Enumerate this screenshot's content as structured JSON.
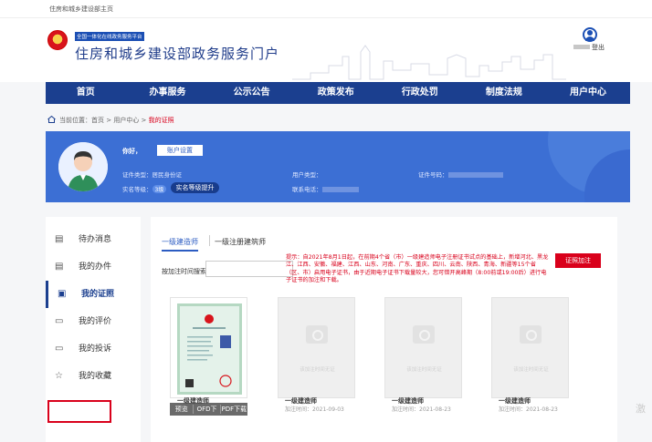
{
  "topbar": {
    "text": "住房和城乡建设部主页"
  },
  "header": {
    "badge_small": "全国一体化在线政务服务平台",
    "title": "住房和城乡建设部政务服务门户",
    "logout": "登出",
    "emblem_icon": "national-emblem-icon",
    "user_icon": "user-icon"
  },
  "nav": [
    "首页",
    "办事服务",
    "公示公告",
    "政策发布",
    "行政处罚",
    "制度法规",
    "用户中心"
  ],
  "breadcrumb": {
    "prefix": "当前位置：首页 > 用户中心 > ",
    "current": "我的证照"
  },
  "profile": {
    "greeting": "你好，",
    "account_settings": "账户设置",
    "cert_type_label": "证件类型：",
    "cert_type_value": "居民身份证",
    "verify_label": "实名等级：",
    "verify_level": "3级",
    "verify_upgrade": "实名等级提升",
    "user_type_label": "用户类型：",
    "contact_label": "联系电话：",
    "cert_no_label": "证件号码："
  },
  "sidebar": [
    {
      "label": "待办消息",
      "icon": "message-icon"
    },
    {
      "label": "我的办件",
      "icon": "document-icon"
    },
    {
      "label": "我的证照",
      "icon": "id-card-icon",
      "active": true
    },
    {
      "label": "我的评价",
      "icon": "comment-icon"
    },
    {
      "label": "我的投诉",
      "icon": "complaint-icon"
    },
    {
      "label": "我的收藏",
      "icon": "star-icon"
    }
  ],
  "main": {
    "tab_active": "一级建造师",
    "tab_other": "一级注册建筑师",
    "search_label": "按加注时间搜索:",
    "search_value": "",
    "notice": "提示：自2021年8月1日起，在前期4个省（市）一级建造师电子注册证书试点的基础上，新增河北、黑龙江、江西、安徽、福建、江西、山东、河南、广东、重庆、四川、云南、陕西、青海、新疆等15个省（区、市）启用电子证书，由于近期电子证书下载量较大，您可错开高峰期（8:00前或19:00后）进行电子证书的加注和下载。",
    "add_button": "证照加注",
    "cards": [
      {
        "title": "一级建造师",
        "date": "",
        "actions": [
          "预览",
          "OFD下载",
          "PDF下载"
        ]
      },
      {
        "title": "一级建造师",
        "date": "加注时间：2021-09-03",
        "placeholder": "该加注时间无证"
      },
      {
        "title": "一级建造师",
        "date": "加注时间：2021-08-23",
        "placeholder": "该加注时间无证"
      },
      {
        "title": "一级建造师",
        "date": "加注时间：2021-08-23",
        "placeholder": "该加注时间无证"
      }
    ]
  },
  "watermark": "激"
}
